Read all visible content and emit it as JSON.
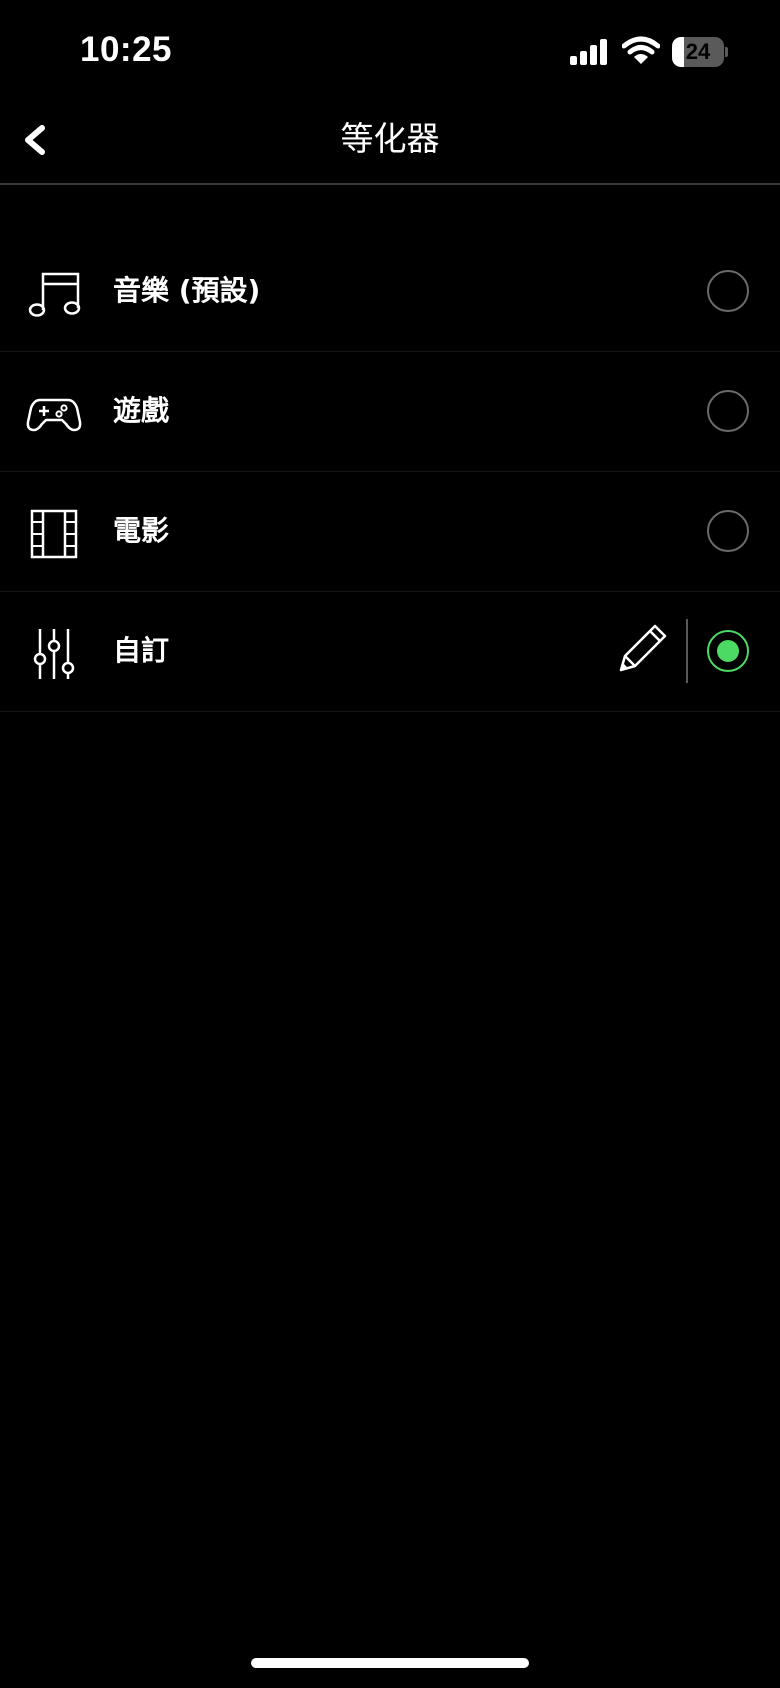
{
  "status_bar": {
    "time": "10:25",
    "battery_level": "24",
    "battery_fraction": 0.24
  },
  "nav": {
    "title": "等化器",
    "back_icon": "chevron-left-icon"
  },
  "presets": [
    {
      "label": "音樂 (預設)",
      "icon": "music-note-icon",
      "selected": false
    },
    {
      "label": "遊戲",
      "icon": "gamepad-icon",
      "selected": false
    },
    {
      "label": "電影",
      "icon": "film-icon",
      "selected": false
    },
    {
      "label": "自訂",
      "icon": "sliders-icon",
      "selected": true,
      "editable": true
    }
  ],
  "colors": {
    "background": "#000000",
    "accent": "#4cd964",
    "radio_border": "#6a6a6a"
  }
}
